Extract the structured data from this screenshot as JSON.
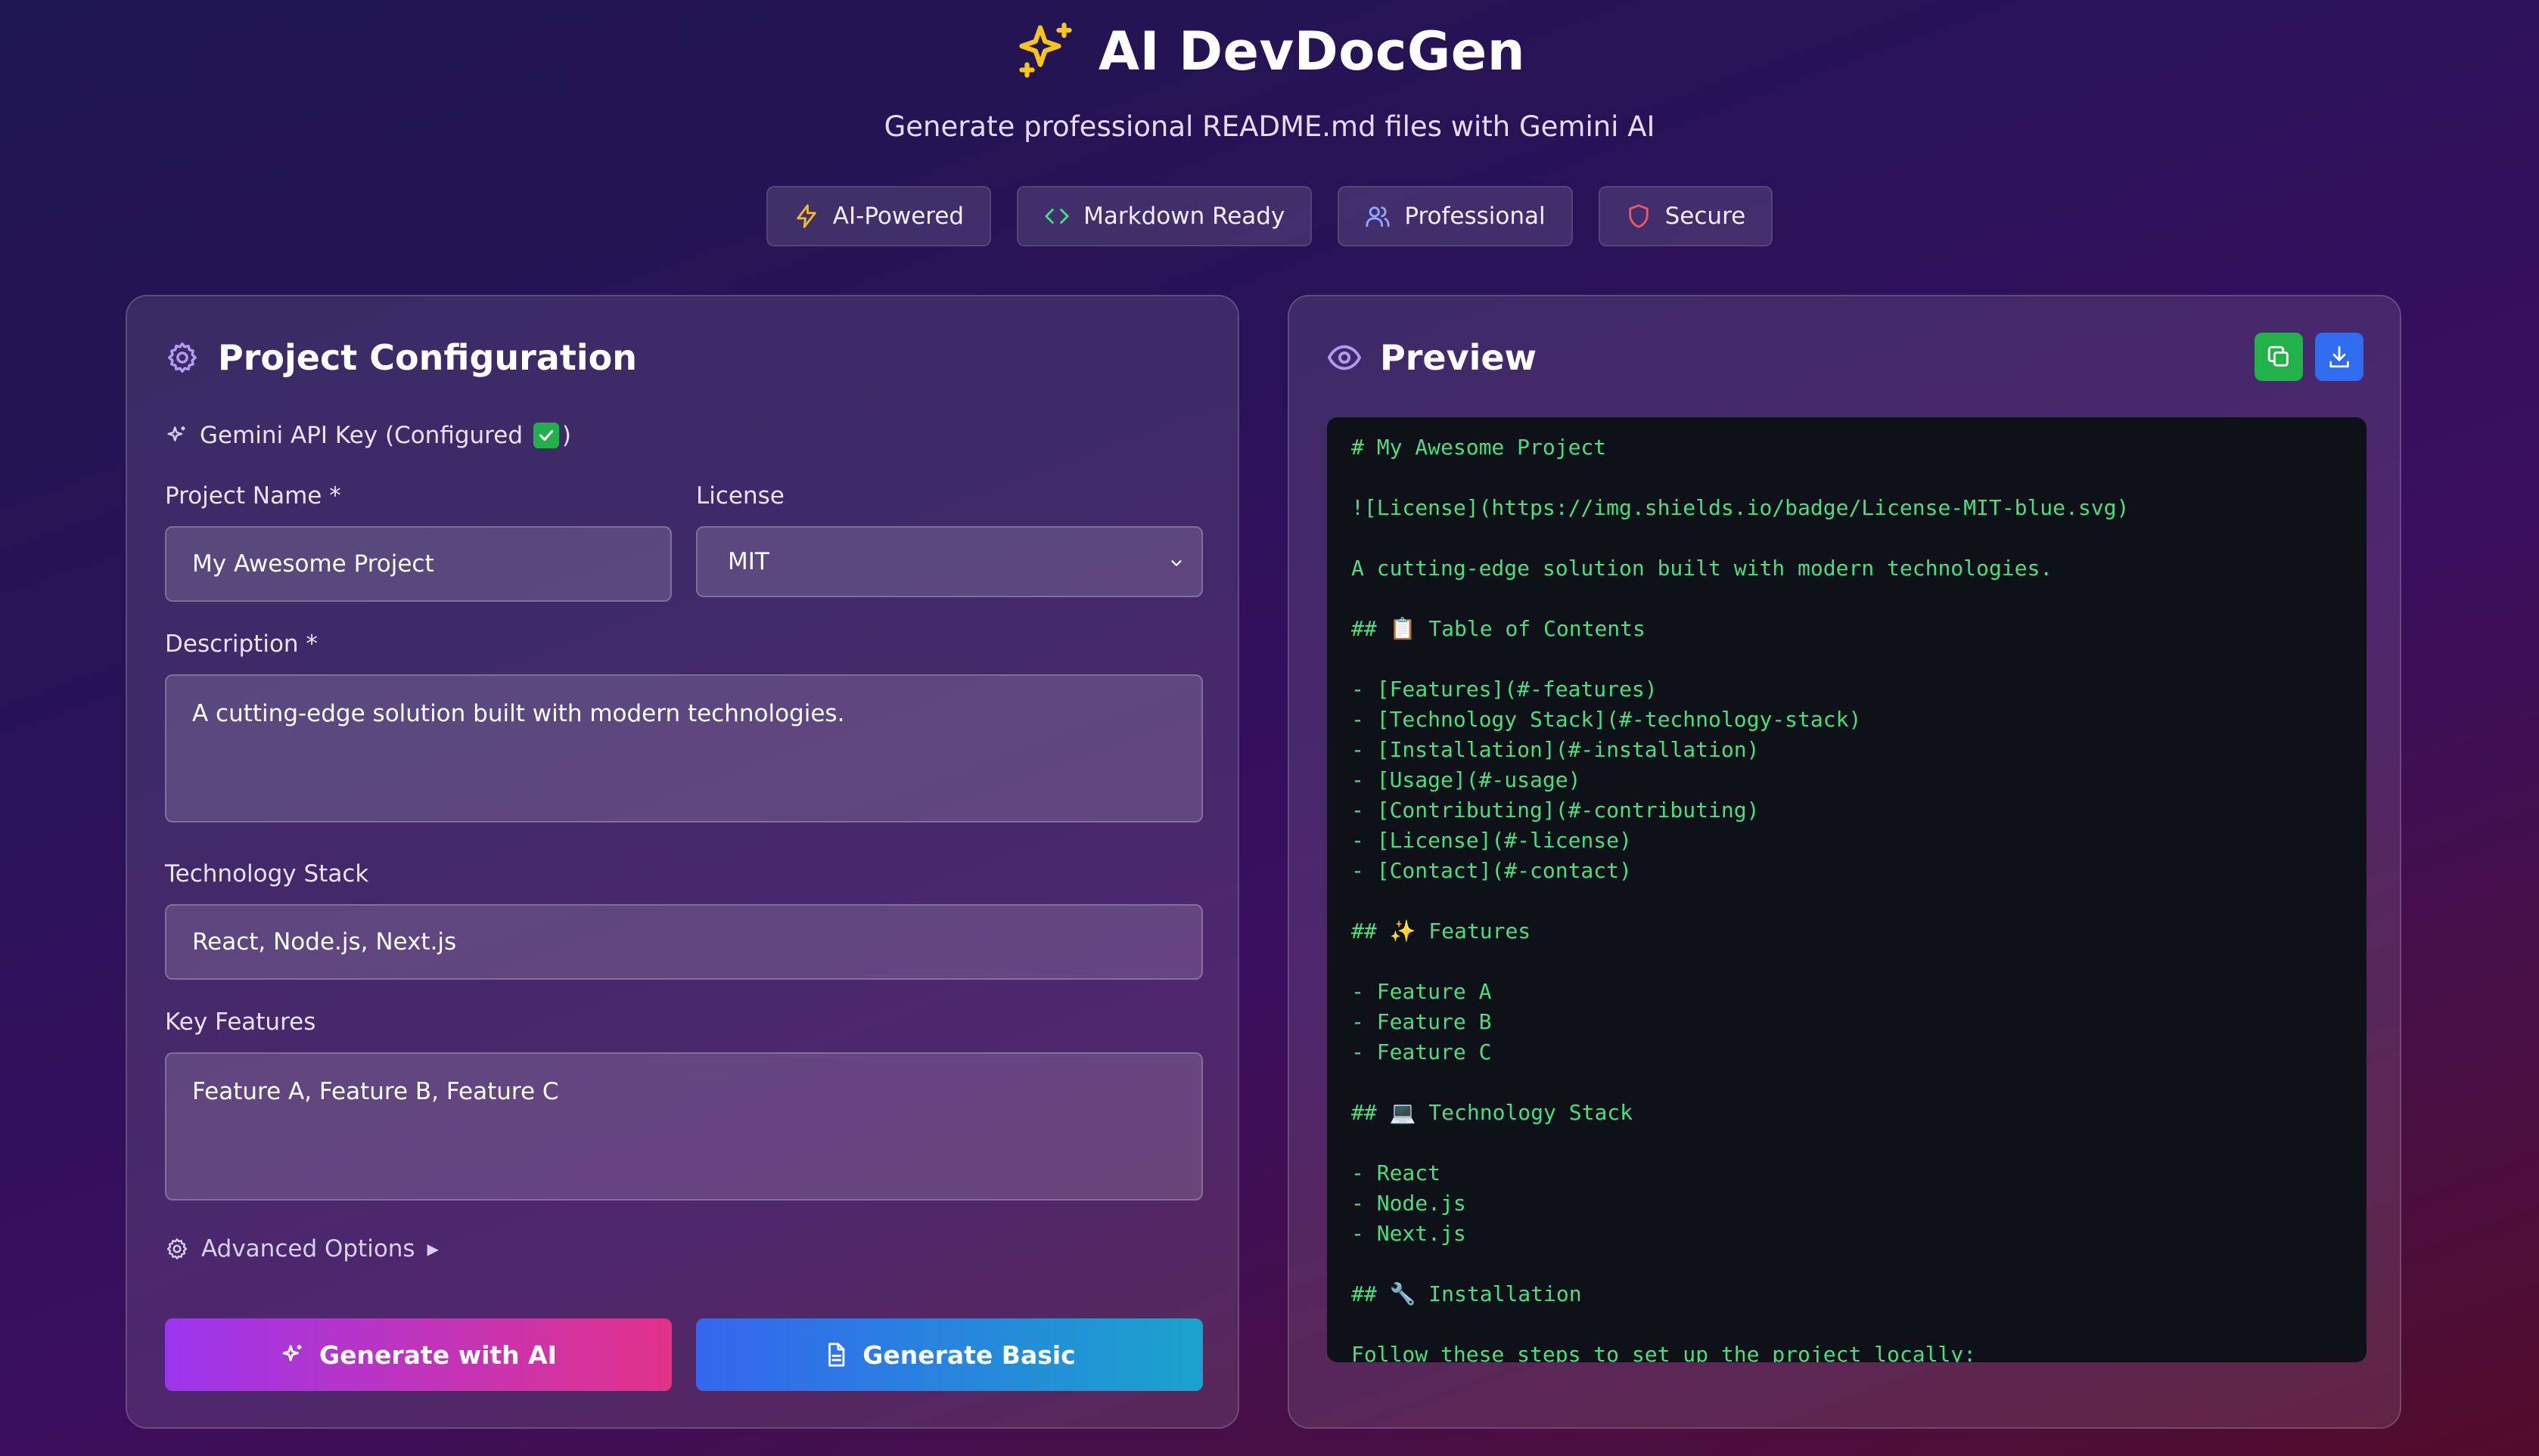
{
  "app": {
    "title": "AI DevDocGen",
    "subtitle": "Generate professional README.md files with Gemini AI"
  },
  "badges": [
    {
      "label": "AI-Powered",
      "icon": "lightning-icon",
      "color": "#f5b82e"
    },
    {
      "label": "Markdown Ready",
      "icon": "code-icon",
      "color": "#4ade80"
    },
    {
      "label": "Professional",
      "icon": "users-icon",
      "color": "#8fa8ff"
    },
    {
      "label": "Secure",
      "icon": "shield-icon",
      "color": "#f0566a"
    }
  ],
  "config": {
    "title": "Project Configuration",
    "api_key_label": "Gemini API Key (Configured",
    "api_key_suffix": ")",
    "project_name": {
      "label": "Project Name *",
      "value": "My Awesome Project"
    },
    "license": {
      "label": "License",
      "value": "MIT"
    },
    "description": {
      "label": "Description *",
      "value": "A cutting-edge solution built with modern technologies."
    },
    "tech_stack": {
      "label": "Technology Stack",
      "value": "React, Node.js, Next.js"
    },
    "features": {
      "label": "Key Features",
      "value": "Feature A, Feature B, Feature C"
    },
    "advanced_label": "Advanced Options",
    "advanced_arrow": "▶",
    "generate_ai_label": "Generate with AI",
    "generate_basic_label": "Generate Basic"
  },
  "preview": {
    "title": "Preview",
    "lines": [
      "# My Awesome Project",
      "",
      "![License](https://img.shields.io/badge/License-MIT-blue.svg)",
      "",
      "A cutting-edge solution built with modern technologies.",
      "",
      "## 📋 Table of Contents",
      "",
      "- [Features](#-features)",
      "- [Technology Stack](#-technology-stack)",
      "- [Installation](#-installation)",
      "- [Usage](#-usage)",
      "- [Contributing](#-contributing)",
      "- [License](#-license)",
      "- [Contact](#-contact)",
      "",
      "## ✨ Features",
      "",
      "- Feature A",
      "- Feature B",
      "- Feature C",
      "",
      "## 💻 Technology Stack",
      "",
      "- React",
      "- Node.js",
      "- Next.js",
      "",
      "## 🔧 Installation",
      "",
      "Follow these steps to set up the project locally:"
    ]
  },
  "colors": {
    "accent_purple": "#9b36ee",
    "accent_pink": "#e2328a",
    "accent_blue": "#3566ee",
    "accent_cyan": "#1aa3cc",
    "code_green": "#4ade80",
    "title_star": "#f5c518"
  }
}
